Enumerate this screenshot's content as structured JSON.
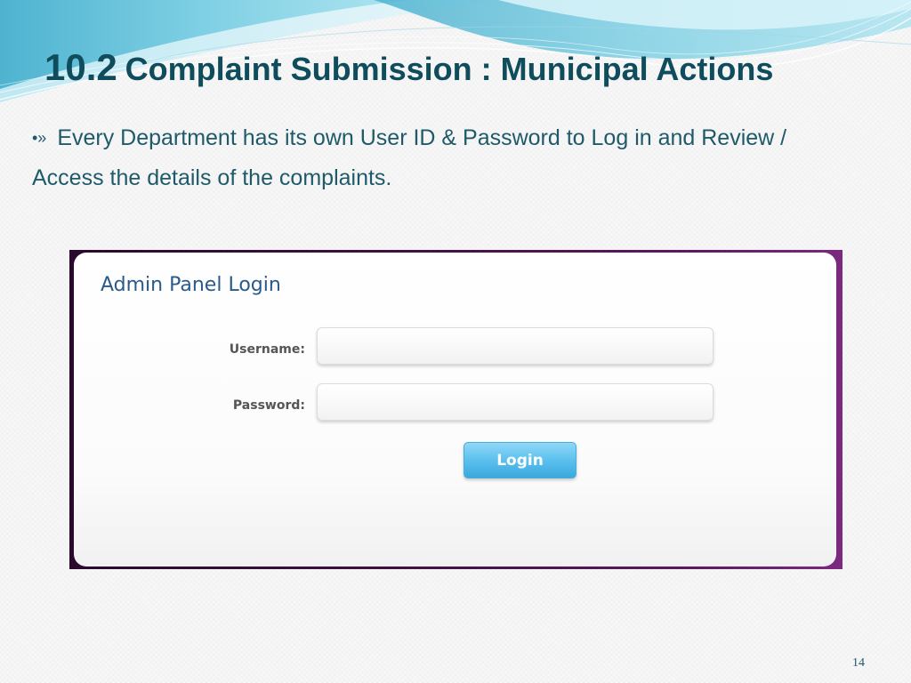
{
  "slide": {
    "title_number": "10.2",
    "title_text": "Complaint Submission : Municipal Actions",
    "bullet_marker": "•»",
    "bullet_text": "Every Department has its own User ID & Password to Log in and Review / Access the details of the complaints.",
    "page_number": "14"
  },
  "admin_panel": {
    "title": "Admin Panel Login",
    "username_label": "Username:",
    "username_value": "",
    "password_label": "Password:",
    "password_value": "",
    "login_label": "Login"
  },
  "colors": {
    "title": "#0f4c5c",
    "body_text": "#1f5a6b",
    "panel_title": "#2a5a8a",
    "login_button": "#5cc0ee",
    "frame": "#4a1550"
  }
}
